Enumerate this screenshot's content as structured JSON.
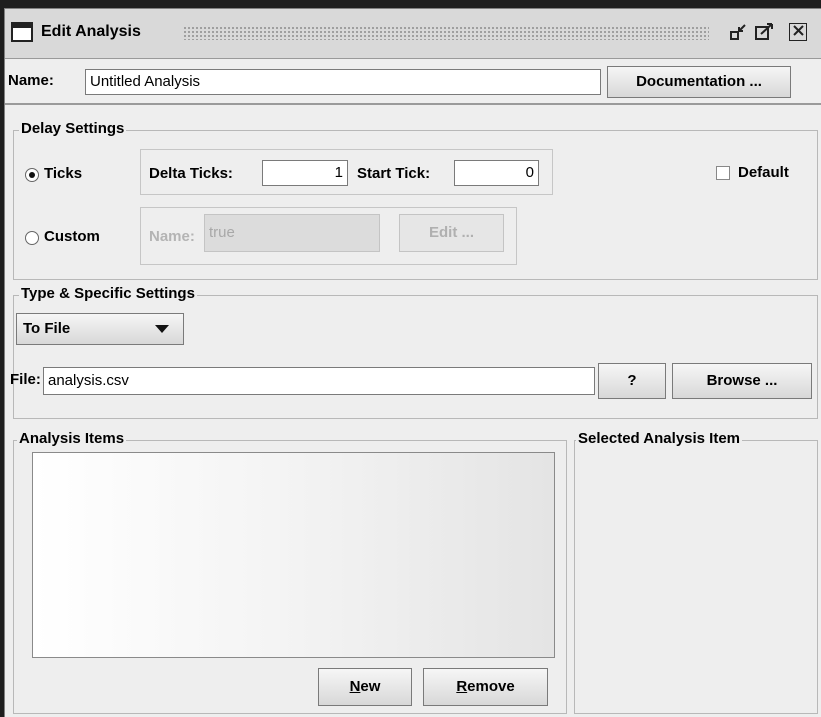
{
  "window": {
    "title": "Edit Analysis",
    "controls": {
      "minimize_icon": "minimize-icon",
      "maximize_icon": "maximize-icon",
      "close_icon": "close-icon"
    }
  },
  "name_row": {
    "label": "Name:",
    "value": "Untitled Analysis",
    "documentation_button": "Documentation ..."
  },
  "delay_settings": {
    "title": "Delay Settings",
    "ticks_label": "Ticks",
    "ticks_selected": true,
    "delta_ticks_label": "Delta Ticks:",
    "delta_ticks_value": "1",
    "start_tick_label": "Start Tick:",
    "start_tick_value": "0",
    "default_label": "Default",
    "default_checked": false,
    "custom_label": "Custom",
    "custom_selected": false,
    "custom_name_label": "Name:",
    "custom_name_value": "true",
    "edit_button": "Edit ..."
  },
  "type_settings": {
    "title": "Type & Specific Settings",
    "type_selected": "To File",
    "file_label": "File:",
    "file_value": "analysis.csv",
    "help_button": "?",
    "browse_button": "Browse ..."
  },
  "analysis_items": {
    "title": "Analysis Items",
    "items": [],
    "new_button_mnemonic": "N",
    "new_button_rest": "ew",
    "remove_button_mnemonic": "R",
    "remove_button_rest": "emove"
  },
  "selected_item": {
    "title": "Selected Analysis Item"
  }
}
